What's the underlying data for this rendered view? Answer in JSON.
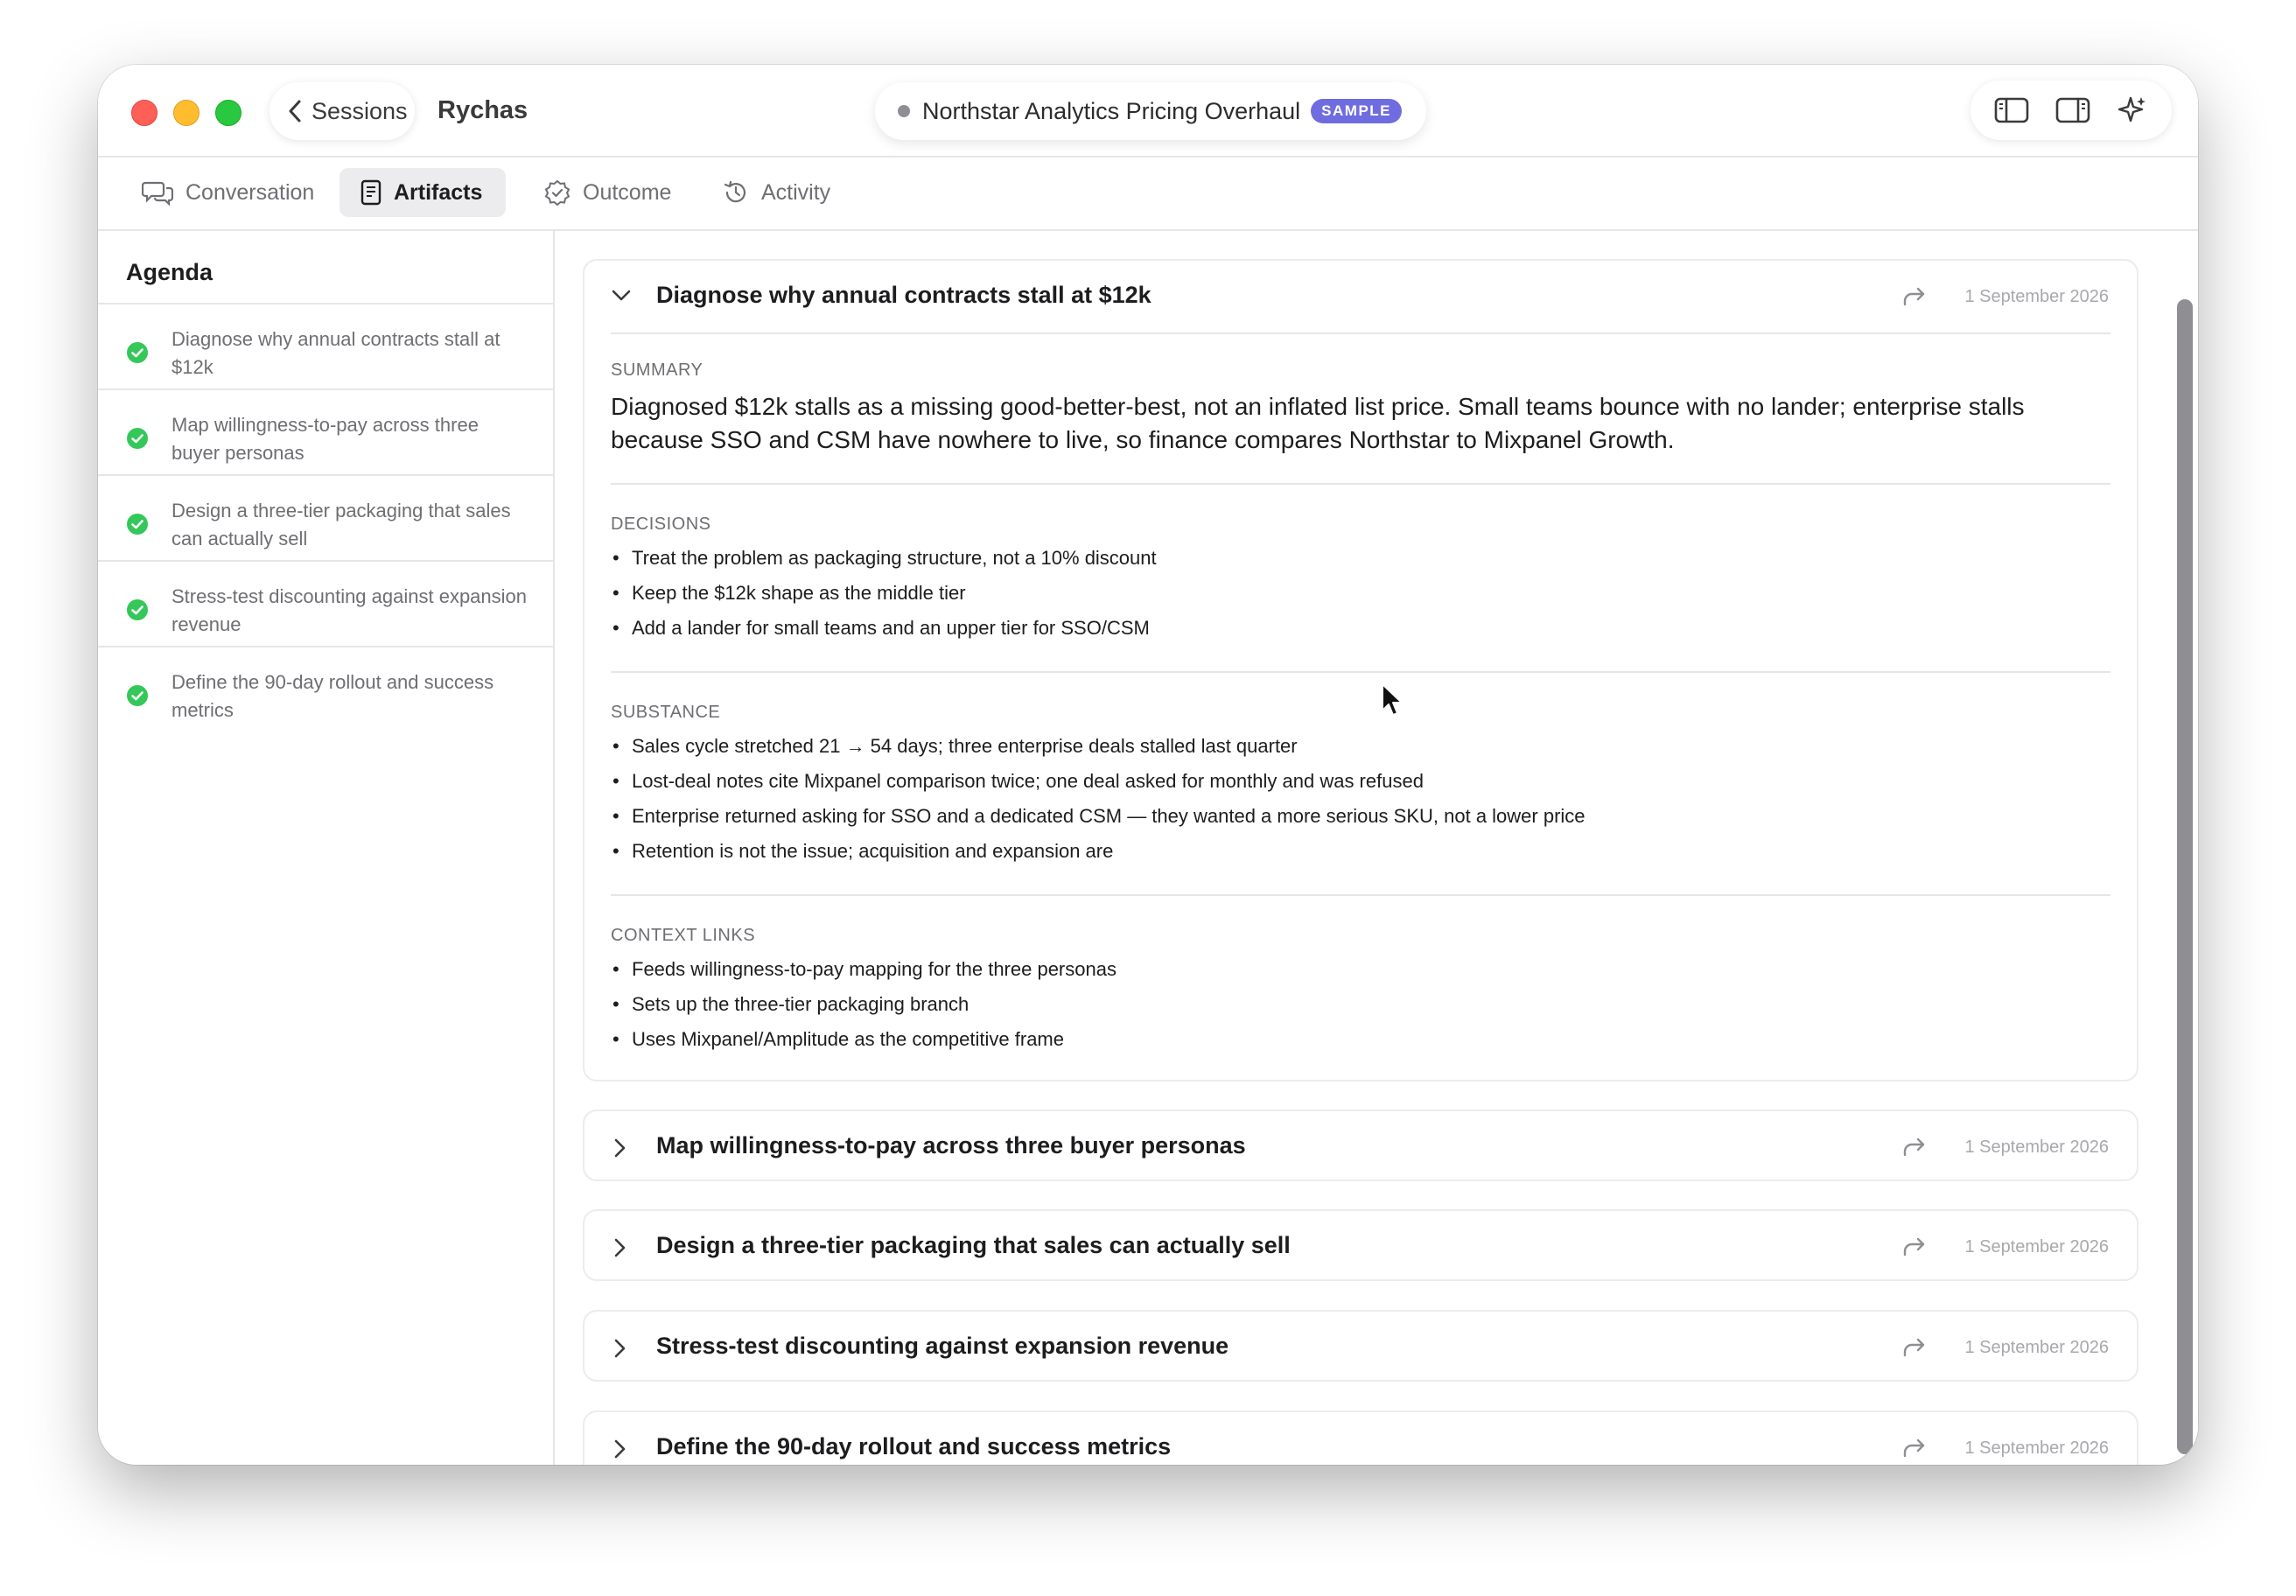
{
  "window": {
    "back_label": "Sessions",
    "app_name": "Rychas",
    "session_title": "Northstar Analytics Pricing Overhaul",
    "session_badge": "SAMPLE"
  },
  "tabs": [
    {
      "label": "Conversation",
      "icon": "chat-bubbles-icon"
    },
    {
      "label": "Artifacts",
      "icon": "document-icon",
      "active": true
    },
    {
      "label": "Outcome",
      "icon": "badge-check-icon"
    },
    {
      "label": "Activity",
      "icon": "history-icon"
    }
  ],
  "sidebar": {
    "heading": "Agenda",
    "items": [
      {
        "label": "Diagnose why annual contracts stall at $12k",
        "status": "complete"
      },
      {
        "label": "Map willingness-to-pay across three buyer personas",
        "status": "complete"
      },
      {
        "label": "Design a three-tier packaging that sales can actually sell",
        "status": "complete"
      },
      {
        "label": "Stress-test discounting against expansion revenue",
        "status": "complete"
      },
      {
        "label": "Define the 90-day rollout and success metrics",
        "status": "complete"
      }
    ]
  },
  "artifacts": [
    {
      "title": "Diagnose why annual contracts stall at $12k",
      "date": "1 September 2026",
      "expanded": true,
      "summary_label": "SUMMARY",
      "summary": "Diagnosed $12k stalls as a missing good-better-best, not an inflated list price. Small teams bounce with no lander; enterprise stalls because SSO and CSM have nowhere to live, so finance compares Northstar to Mixpanel Growth.",
      "decisions_label": "DECISIONS",
      "decisions": [
        "Treat the problem as packaging structure, not a 10% discount",
        "Keep the $12k shape as the middle tier",
        "Add a lander for small teams and an upper tier for SSO/CSM"
      ],
      "substance_label": "SUBSTANCE",
      "substance": [
        "Sales cycle stretched 21 → 54 days; three enterprise deals stalled last quarter",
        "Lost-deal notes cite Mixpanel comparison twice; one deal asked for monthly and was refused",
        "Enterprise returned asking for SSO and a dedicated CSM — they wanted a more serious SKU, not a lower price",
        "Retention is not the issue; acquisition and expansion are"
      ],
      "context_label": "CONTEXT LINKS",
      "context_links": [
        "Feeds willingness-to-pay mapping for the three personas",
        "Sets up the three-tier packaging branch",
        "Uses Mixpanel/Amplitude as the competitive frame"
      ]
    },
    {
      "title": "Map willingness-to-pay across three buyer personas",
      "date": "1 September 2026",
      "expanded": false
    },
    {
      "title": "Design a three-tier packaging that sales can actually sell",
      "date": "1 September 2026",
      "expanded": false
    },
    {
      "title": "Stress-test discounting against expansion revenue",
      "date": "1 September 2026",
      "expanded": false
    },
    {
      "title": "Define the 90-day rollout and success metrics",
      "date": "1 September 2026",
      "expanded": false
    }
  ],
  "colors": {
    "accent_badge": "#6f6ce0",
    "check_green": "#34c759",
    "close_red": "#fe5f57",
    "minimize_yellow": "#febc2e",
    "zoom_green": "#28c840"
  }
}
